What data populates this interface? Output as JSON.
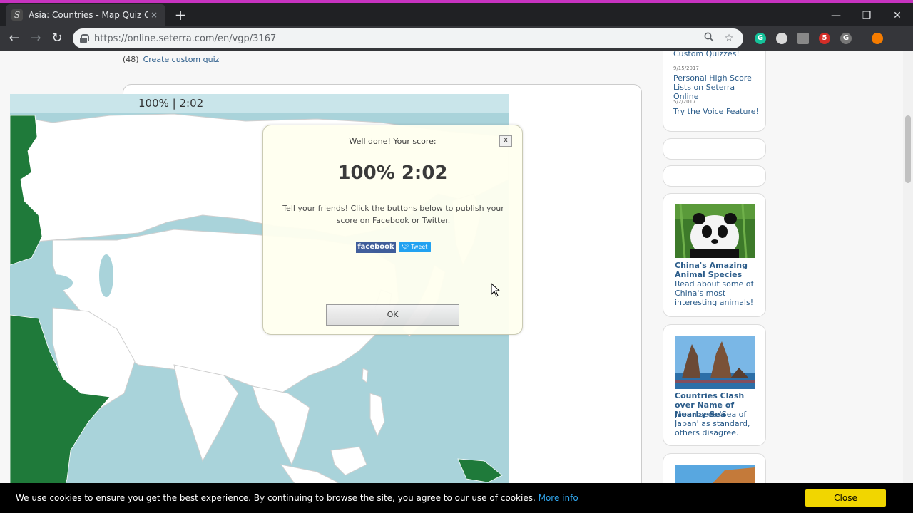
{
  "browser": {
    "tab_title": "Asia: Countries - Map Quiz Game",
    "tab_close": "×",
    "new_tab": "+",
    "url": "https://online.seterra.com/en/vgp/3167",
    "window_controls": {
      "minimize": "—",
      "restore": "❐",
      "close": "✕"
    },
    "nav": {
      "back": "←",
      "forward": "→",
      "reload": "↻"
    },
    "extensions": [
      {
        "name": "grammarly-icon",
        "label": "G",
        "color": "#15c39a"
      },
      {
        "name": "circle-extension-icon",
        "label": "",
        "color": "#dadada"
      },
      {
        "name": "grid-extension-icon",
        "label": "",
        "color": "#888888"
      },
      {
        "name": "lastpass-icon",
        "label": "5",
        "color": "#d32d27"
      },
      {
        "name": "g-extension-icon",
        "label": "G",
        "color": "#777777"
      },
      {
        "name": "profile-avatar-icon",
        "label": "",
        "color": "#f57c00"
      }
    ]
  },
  "page": {
    "quiz_count": "(48)",
    "create_custom_quiz": "Create custom quiz",
    "map_score": "100% | 2:02"
  },
  "modal": {
    "heading": "Well done! Your score:",
    "close_label": "X",
    "score": "100% 2:02",
    "message": "Tell your friends! Click the buttons below to publish your score on Facebook or Twitter.",
    "facebook_label": "facebook",
    "tweet_label": "Tweet",
    "ok_label": "OK"
  },
  "sidebar": {
    "news": [
      {
        "date": "",
        "title": "Custom Quizzes!"
      },
      {
        "date": "9/15/2017",
        "title": "Personal High Score Lists on Seterra Online"
      },
      {
        "date": "5/2/2017",
        "title": "Try the Voice Feature!"
      }
    ],
    "articles": [
      {
        "title": "China's Amazing Animal Species",
        "desc": "Read about some of China's most interesting animals!"
      },
      {
        "title": "Countries Clash over Name of Nearby Sea",
        "desc": "Japan sees 'Sea of Japan' as standard, others disagree."
      }
    ]
  },
  "cookie": {
    "text": "We use cookies to ensure you get the best experience. By continuing to browse the site, you agree to our use of cookies.",
    "more_info": "More info",
    "close_label": "Close"
  },
  "colors": {
    "map_water": "#a9d3da",
    "map_land": "#ffffff",
    "map_answered": "#1f7a3a",
    "link": "#2b5c8a",
    "cookie_button": "#f1d600"
  }
}
